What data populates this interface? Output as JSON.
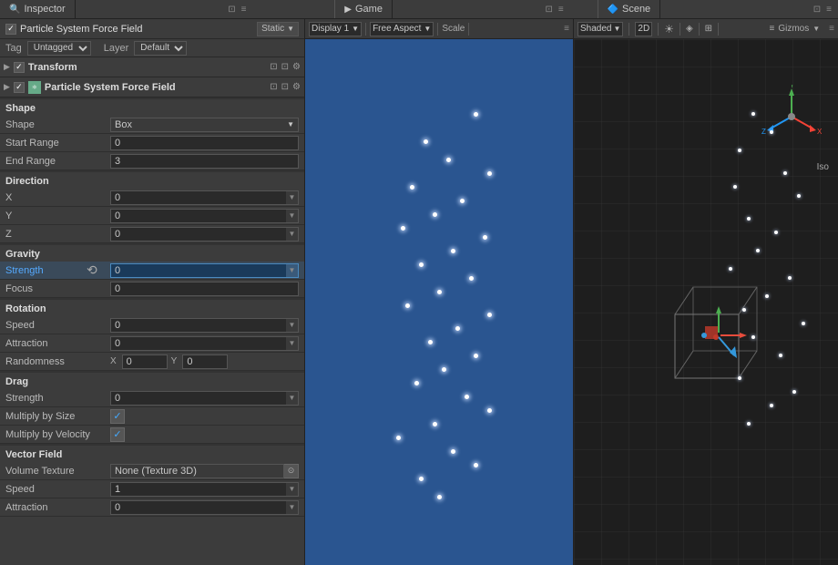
{
  "inspector": {
    "title": "Inspector",
    "lock_icon": "🔒",
    "object_name": "Particle System Force Field",
    "static_label": "Static",
    "tag_label": "Tag",
    "tag_value": "Untagged",
    "layer_label": "Layer",
    "layer_value": "Default",
    "transform_label": "Transform",
    "component_label": "Particle System Force Field",
    "shape_section": "Shape",
    "shape_label": "Shape",
    "shape_value": "Box",
    "start_range_label": "Start Range",
    "start_range_value": "0",
    "end_range_label": "End Range",
    "end_range_value": "3",
    "direction_section": "Direction",
    "dir_x_label": "X",
    "dir_x_value": "0",
    "dir_y_label": "Y",
    "dir_y_value": "0",
    "dir_z_label": "Z",
    "dir_z_value": "0",
    "gravity_section": "Gravity",
    "strength_label": "Strength",
    "strength_value": "0",
    "focus_label": "Focus",
    "focus_value": "0",
    "rotation_section": "Rotation",
    "rot_speed_label": "Speed",
    "rot_speed_value": "0",
    "rot_attraction_label": "Attraction",
    "rot_attraction_value": "0",
    "rot_randomness_label": "Randomness",
    "rot_random_x_value": "0",
    "rot_random_y_value": "0",
    "drag_section": "Drag",
    "drag_strength_label": "Strength",
    "drag_strength_value": "0",
    "drag_mult_size_label": "Multiply by Size",
    "drag_mult_velocity_label": "Multiply by Velocity",
    "vector_section": "Vector Field",
    "vec_volume_label": "Volume Texture",
    "vec_volume_value": "None (Texture 3D)",
    "vec_speed_label": "Speed",
    "vec_speed_value": "1",
    "vec_attraction_label": "Attraction",
    "vec_attraction_value": "0"
  },
  "game": {
    "tab_label": "Game",
    "display_label": "Display 1",
    "aspect_label": "Free Aspect",
    "scale_label": "Scale"
  },
  "scene": {
    "tab_label": "Scene",
    "shaded_label": "Shaded",
    "mode_2d_label": "2D",
    "gizmos_label": "Gizmos",
    "iso_label": "Iso"
  }
}
